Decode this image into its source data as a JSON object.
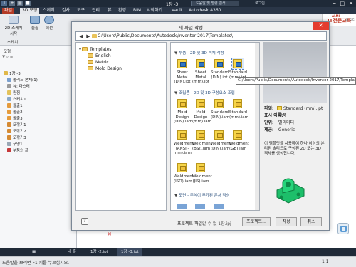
{
  "titlebar": {
    "doc_title": "1장 -3",
    "search_placeholder": "도움말 및 명령 검색...",
    "user": "로그인",
    "min": "─",
    "max": "□",
    "close": "✕"
  },
  "menu": {
    "tabs": [
      "파일",
      "3D 모형",
      "스케치",
      "검사",
      "도구",
      "관리",
      "뷰",
      "환경",
      "BIM",
      "시작하기",
      "Vault",
      "Autodesk A360"
    ],
    "active_index": 1
  },
  "ribbon": {
    "buttons": [
      "2D 스케치 시작",
      "돌출",
      "회전"
    ],
    "group_label": "스케치",
    "logo_top": "ALMI",
    "logo_main": "IT전문교육",
    "logo_sub": "의 리더"
  },
  "browser": {
    "title": "모형",
    "items": [
      "1장 -3",
      "솔리드 본체(1)",
      "뷰: 마스터",
      "원점",
      "스케치1",
      "돌출1",
      "돌출2",
      "돌출3",
      "모깎기1",
      "모깎기2",
      "모깎기3",
      "구멍1",
      "부품의 끝"
    ]
  },
  "dialog": {
    "title": "새 파일 작성",
    "close": "✕",
    "address_path": "C:\\Users\\Public\\Documents\\Autodesk\\Inventor 2017\\Templates\\",
    "tree": [
      "Templates",
      "English",
      "Metric",
      "Mold Design"
    ],
    "sections": [
      {
        "title": "부품 - 2D 및 3D 객체 작성",
        "items": [
          "Sheet Metal (DIN).ipt",
          "Sheet Metal (mm).ipt",
          "Standard (DIN).ipt",
          "Standard (mm).ipt"
        ]
      },
      {
        "title": "조립품 - 2D 및 3D 구성요소 조립",
        "items": [
          "Mold Design (DIN).iam",
          "Mold Design (mm).iam",
          "Standard (DIN).iam",
          "Standard (mm).iam",
          "Weldment (ANSI - mm).iam",
          "Weldment (BSI).iam",
          "Weldment (DIN).iam",
          "Weldment (GB).iam",
          "Weldment (ISO).iam",
          "Weldment (JIS).iam"
        ]
      },
      {
        "title": "도면 - 주석이 추가된 문서 작성",
        "items": []
      }
    ],
    "selected_item": "Standard (mm).ipt",
    "tooltip": "C:/Users/Public/Documents/Autodesk/Inventor 2017/Templa",
    "info": {
      "file_label": "파일:",
      "file_value": "Standard (mm).ipt",
      "type_label": "표시 이름:",
      "type_value": "부품",
      "unit_label": "단위:",
      "unit_value": "밀리미터",
      "std_label": "제공:",
      "std_value": "Generic",
      "description": "이 템플릿을 사용하여 하나 이상의 분리된 솔리드로 구성된 2D 또는 3D 객체를 생성합니다."
    },
    "bottom": {
      "help": "?",
      "project_label": "프로젝트 파일:",
      "project_value": "알 수 없 1장.ipj",
      "projects_btn": "프로젝트...",
      "create_btn": "작성",
      "cancel_btn": "취소"
    }
  },
  "doctabs": [
    "내 홈",
    "1장 -2.ipt",
    "1장 -3.ipt"
  ],
  "doctabs_active": 2,
  "status": {
    "text": "도움말을 보려면 F1 키를 누르십시오.",
    "right": "1    1"
  },
  "colors": {
    "file_tab": "#b43b26",
    "title_bg": "#1f2a38",
    "dialog_close": "#e43b2e",
    "template_yellow": "#f6d64a",
    "template_blue": "#2f76c6",
    "preview_green": "#1dbf6a"
  }
}
